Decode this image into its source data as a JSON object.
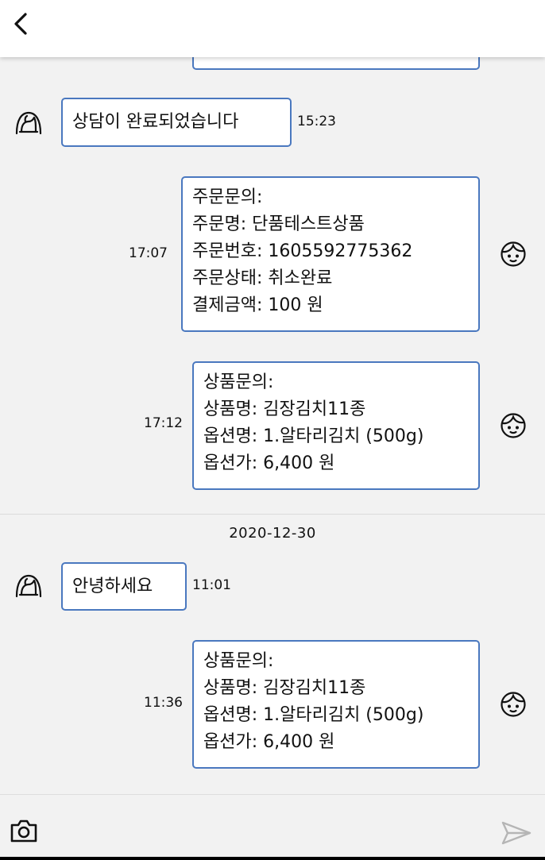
{
  "header": {
    "back_icon": "chevron-left-icon"
  },
  "messages": [
    {
      "sender": "agent",
      "time": "15:23",
      "lines": [
        "상담이 완료되었습니다"
      ]
    },
    {
      "sender": "user",
      "time": "17:07",
      "lines": [
        "주문문의:",
        "주문명: 단품테스트상품",
        "주문번호: 1605592775362",
        "주문상태: 취소완료",
        "결제금액: 100 원"
      ]
    },
    {
      "sender": "user",
      "time": "17:12",
      "lines": [
        "상품문의:",
        "상품명: 김장김치11종",
        "옵션명: 1.알타리김치 (500g)",
        "옵션가: 6,400 원"
      ]
    },
    {
      "sender": "agent",
      "time": "11:01",
      "lines": [
        "안녕하세요"
      ]
    },
    {
      "sender": "user",
      "time": "11:36",
      "lines": [
        "상품문의:",
        "상품명: 김장김치11종",
        "옵션명: 1.알타리김치 (500g)",
        "옵션가: 6,400 원"
      ]
    }
  ],
  "date_separator": "2020-12-30",
  "input": {
    "placeholder": "",
    "camera_icon": "camera-icon",
    "send_icon": "send-icon"
  },
  "colors": {
    "bubble_border": "#4a78bf",
    "background": "#f2f2f2",
    "send_icon": "#b5b5b5"
  }
}
